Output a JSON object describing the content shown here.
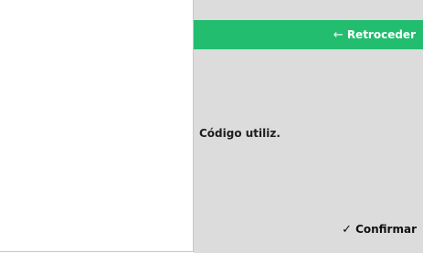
{
  "header": {
    "back_label": "Retroceder",
    "back_icon": "arrow-left-icon"
  },
  "form": {
    "code_label": "Código utiliz."
  },
  "footer": {
    "confirm_label": "Confirmar",
    "confirm_icon": "check-icon"
  },
  "colors": {
    "accent": "#22bd6e",
    "panel": "#dcdcdc"
  }
}
